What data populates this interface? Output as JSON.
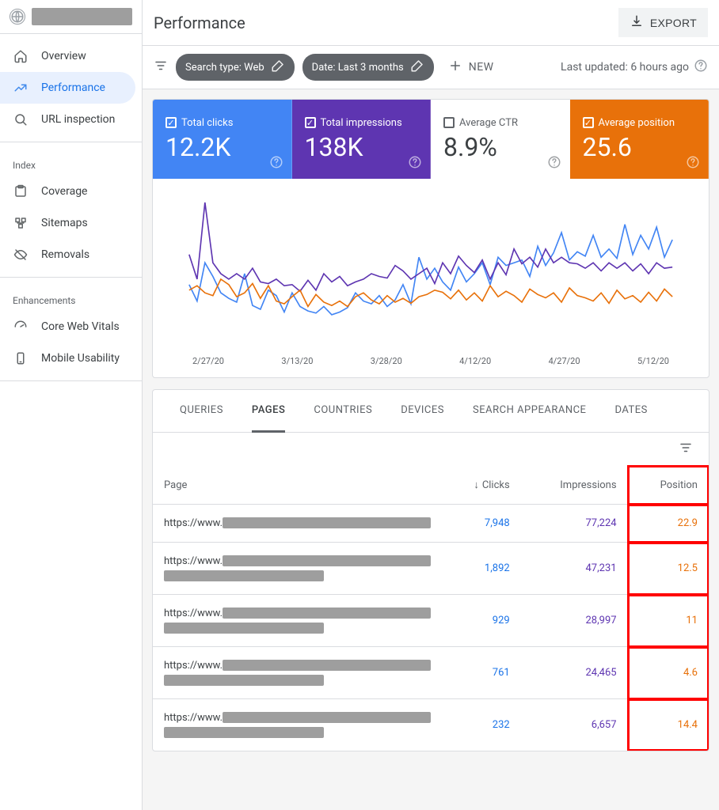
{
  "sidebar": {
    "groups": [
      {
        "items": [
          {
            "icon": "home",
            "label": "Overview"
          },
          {
            "icon": "trend",
            "label": "Performance",
            "active": true
          },
          {
            "icon": "search",
            "label": "URL inspection"
          }
        ]
      },
      {
        "title": "Index",
        "items": [
          {
            "icon": "coverage",
            "label": "Coverage"
          },
          {
            "icon": "sitemap",
            "label": "Sitemaps"
          },
          {
            "icon": "removals",
            "label": "Removals"
          }
        ]
      },
      {
        "title": "Enhancements",
        "items": [
          {
            "icon": "speed",
            "label": "Core Web Vitals"
          },
          {
            "icon": "mobile",
            "label": "Mobile Usability"
          }
        ]
      }
    ]
  },
  "header": {
    "title": "Performance",
    "export": "EXPORT"
  },
  "filterbar": {
    "chips": [
      {
        "label": "Search type: Web"
      },
      {
        "label": "Date: Last 3 months"
      }
    ],
    "new_label": "NEW",
    "last_updated": "Last updated: 6 hours ago"
  },
  "metrics": [
    {
      "key": "clicks",
      "label": "Total clicks",
      "value": "12.2K",
      "checked": true,
      "cls": "m-blue"
    },
    {
      "key": "impr",
      "label": "Total impressions",
      "value": "138K",
      "checked": true,
      "cls": "m-purple"
    },
    {
      "key": "ctr",
      "label": "Average CTR",
      "value": "8.9%",
      "checked": false,
      "cls": "m-white"
    },
    {
      "key": "pos",
      "label": "Average position",
      "value": "25.6",
      "checked": true,
      "cls": "m-orange"
    }
  ],
  "chart_data": {
    "type": "line",
    "x_labels": [
      "2/27/20",
      "3/13/20",
      "3/28/20",
      "4/12/20",
      "4/27/20",
      "5/12/20"
    ],
    "series": [
      {
        "name": "Total clicks",
        "color": "#4285f4",
        "values": [
          110,
          80,
          150,
          125,
          95,
          85,
          78,
          130,
          72,
          65,
          100,
          90,
          60,
          95,
          70,
          62,
          58,
          70,
          55,
          60,
          68,
          95,
          80,
          75,
          90,
          70,
          82,
          110,
          75,
          160,
          120,
          140,
          115,
          100,
          142,
          115,
          130,
          150,
          110,
          160,
          145,
          150,
          155,
          125,
          180,
          145,
          168,
          205,
          155,
          170,
          162,
          200,
          160,
          175,
          158,
          220,
          165,
          200,
          175,
          215,
          160,
          192
        ]
      },
      {
        "name": "Total impressions",
        "color": "#5e35b1",
        "values": [
          165,
          120,
          260,
          150,
          130,
          120,
          130,
          120,
          140,
          115,
          112,
          120,
          108,
          110,
          98,
          118,
          100,
          130,
          115,
          125,
          108,
          115,
          120,
          130,
          125,
          122,
          145,
          135,
          120,
          130,
          140,
          112,
          150,
          130,
          162,
          145,
          132,
          155,
          120,
          150,
          128,
          175,
          148,
          160,
          142,
          175,
          150,
          160,
          150,
          148,
          140,
          150,
          135,
          150,
          140,
          150,
          135,
          148,
          130,
          150,
          140,
          142
        ]
      },
      {
        "name": "Average position",
        "color": "#e8710a",
        "values": [
          100,
          108,
          95,
          90,
          120,
          110,
          88,
          95,
          112,
          85,
          108,
          80,
          75,
          88,
          100,
          70,
          92,
          78,
          72,
          80,
          70,
          88,
          95,
          82,
          75,
          90,
          78,
          85,
          76,
          88,
          92,
          100,
          96,
          84,
          100,
          82,
          95,
          80,
          108,
          88,
          98,
          90,
          78,
          102,
          92,
          86,
          95,
          78,
          104,
          90,
          86,
          80,
          95,
          76,
          100,
          84,
          90,
          78,
          96,
          80,
          102,
          88
        ]
      }
    ]
  },
  "tabs": [
    "QUERIES",
    "PAGES",
    "COUNTRIES",
    "DEVICES",
    "SEARCH APPEARANCE",
    "DATES"
  ],
  "active_tab": 1,
  "table": {
    "columns": [
      "Page",
      "Clicks",
      "Impressions",
      "Position"
    ],
    "sort_col": 1,
    "rows": [
      {
        "url": "https://www.",
        "clicks": "7,948",
        "impr": "77,224",
        "pos": "22.9",
        "lines": 1
      },
      {
        "url": "https://www.",
        "clicks": "1,892",
        "impr": "47,231",
        "pos": "12.5",
        "lines": 2
      },
      {
        "url": "https://www.",
        "clicks": "929",
        "impr": "28,997",
        "pos": "11",
        "lines": 2
      },
      {
        "url": "https://www.",
        "clicks": "761",
        "impr": "24,465",
        "pos": "4.6",
        "lines": 2
      },
      {
        "url": "https://www.",
        "clicks": "232",
        "impr": "6,657",
        "pos": "14.4",
        "lines": 2
      }
    ]
  }
}
